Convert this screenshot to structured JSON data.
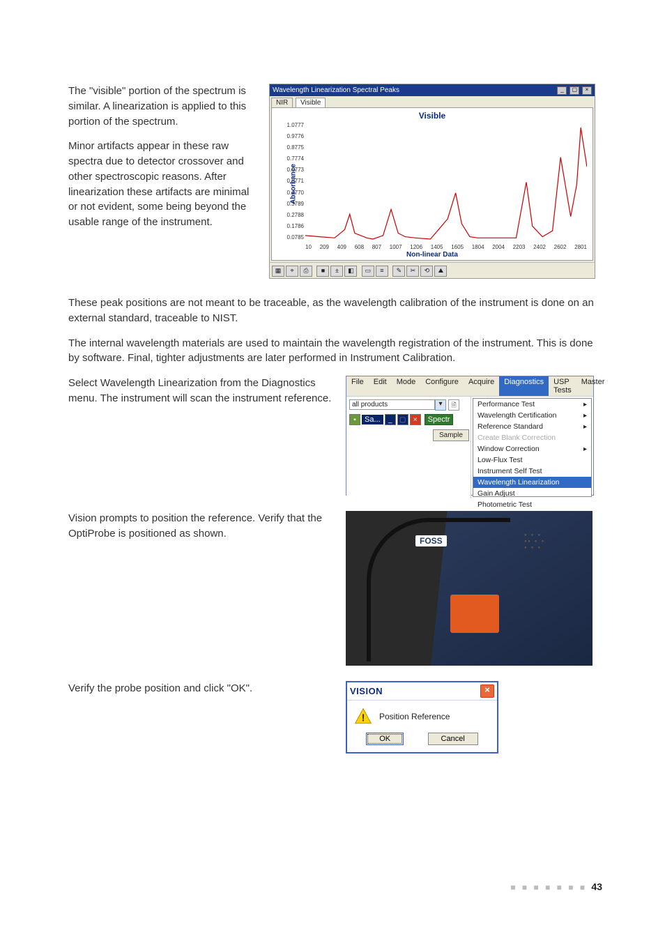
{
  "paragraphs": {
    "p1": "The \"visible\" portion of the spectrum is similar. A linearization is applied to this portion of the spectrum.",
    "p2": "Minor artifacts appear in these raw spectra due to detector crossover and other spectroscopic reasons. After linearization these artifacts are minimal or not evident, some being beyond the usable range of the instrument.",
    "p3": "These peak positions are not meant to be traceable, as the wavelength calibration of the instrument is done on an external standard, traceable to NIST.",
    "p4": "The internal wavelength materials are used to maintain the wavelength registration of the instrument. This is done by software. Final, tighter adjustments are later performed in Instrument Calibration.",
    "p5": "Select Wavelength Linearization from the Diagnostics menu. The instrument will scan the instrument reference.",
    "p6": "Vision prompts to position the reference. Verify that the OptiProbe is positioned as shown.",
    "p7": "Verify the probe position and click \"OK\"."
  },
  "chart_window": {
    "title": "Wavelength Linearization Spectral Peaks",
    "tabs": [
      "NIR",
      "Visible"
    ],
    "active_tab": "Visible"
  },
  "chart_data": {
    "type": "line",
    "title": "Visible",
    "xlabel": "Non-linear Data",
    "ylabel": "Absorbance",
    "y_ticks": [
      "1.0777",
      "0.9776",
      "0.8775",
      "0.7774",
      "0.6773",
      "0.5771",
      "0.4770",
      "0.3789",
      "0.2788",
      "0.1786",
      "0.0785"
    ],
    "x_ticks": [
      "10",
      "209",
      "409",
      "608",
      "807",
      "1007",
      "1206",
      "1405",
      "1605",
      "1804",
      "2004",
      "2203",
      "2402",
      "2602",
      "2801"
    ],
    "ylim": [
      0.0785,
      1.0777
    ],
    "xlim": [
      10,
      2801
    ],
    "series": [
      {
        "name": "spectrum",
        "color": "#c00",
        "x": [
          10,
          150,
          300,
          400,
          450,
          500,
          620,
          680,
          780,
          860,
          930,
          1000,
          1100,
          1250,
          1420,
          1500,
          1560,
          1640,
          1720,
          1810,
          1950,
          2100,
          2200,
          2260,
          2360,
          2460,
          2540,
          2640,
          2700,
          2740,
          2801
        ],
        "y": [
          0.12,
          0.11,
          0.1,
          0.17,
          0.3,
          0.14,
          0.1,
          0.09,
          0.12,
          0.34,
          0.14,
          0.11,
          0.1,
          0.09,
          0.26,
          0.48,
          0.22,
          0.11,
          0.1,
          0.1,
          0.1,
          0.1,
          0.57,
          0.2,
          0.11,
          0.16,
          0.78,
          0.28,
          0.55,
          1.03,
          0.7
        ]
      }
    ]
  },
  "menubar": [
    "File",
    "Edit",
    "Mode",
    "Configure",
    "Acquire",
    "Diagnostics",
    "USP Tests",
    "Master"
  ],
  "menubar_active": "Diagnostics",
  "leftpane": {
    "dropdown": "all products",
    "sa_label": "Sa...",
    "spect_btn": "Spectr",
    "sample_btn": "Sample"
  },
  "submenu": {
    "items": [
      {
        "label": "Performance Test",
        "enabled": true,
        "arrow": true
      },
      {
        "label": "Wavelength Certification",
        "enabled": true,
        "arrow": true
      },
      {
        "label": "Reference Standard",
        "enabled": true,
        "arrow": true
      },
      {
        "label": "Create Blank Correction",
        "enabled": false,
        "arrow": false
      },
      {
        "label": "Window Correction",
        "enabled": true,
        "arrow": true
      },
      {
        "label": "Low-Flux Test",
        "enabled": true,
        "arrow": false
      },
      {
        "label": "Instrument Self Test",
        "enabled": true,
        "arrow": false
      },
      {
        "label": "Wavelength Linearization",
        "enabled": true,
        "arrow": false,
        "highlight": true
      },
      {
        "label": "Gain Adjust",
        "enabled": true,
        "arrow": false
      },
      {
        "label": "Photometric Test",
        "enabled": true,
        "arrow": false
      }
    ]
  },
  "photo": {
    "brand": "FOSS"
  },
  "dialog": {
    "title": "VISION",
    "message": "Position Reference",
    "ok": "OK",
    "cancel": "Cancel"
  },
  "page_number": "43"
}
